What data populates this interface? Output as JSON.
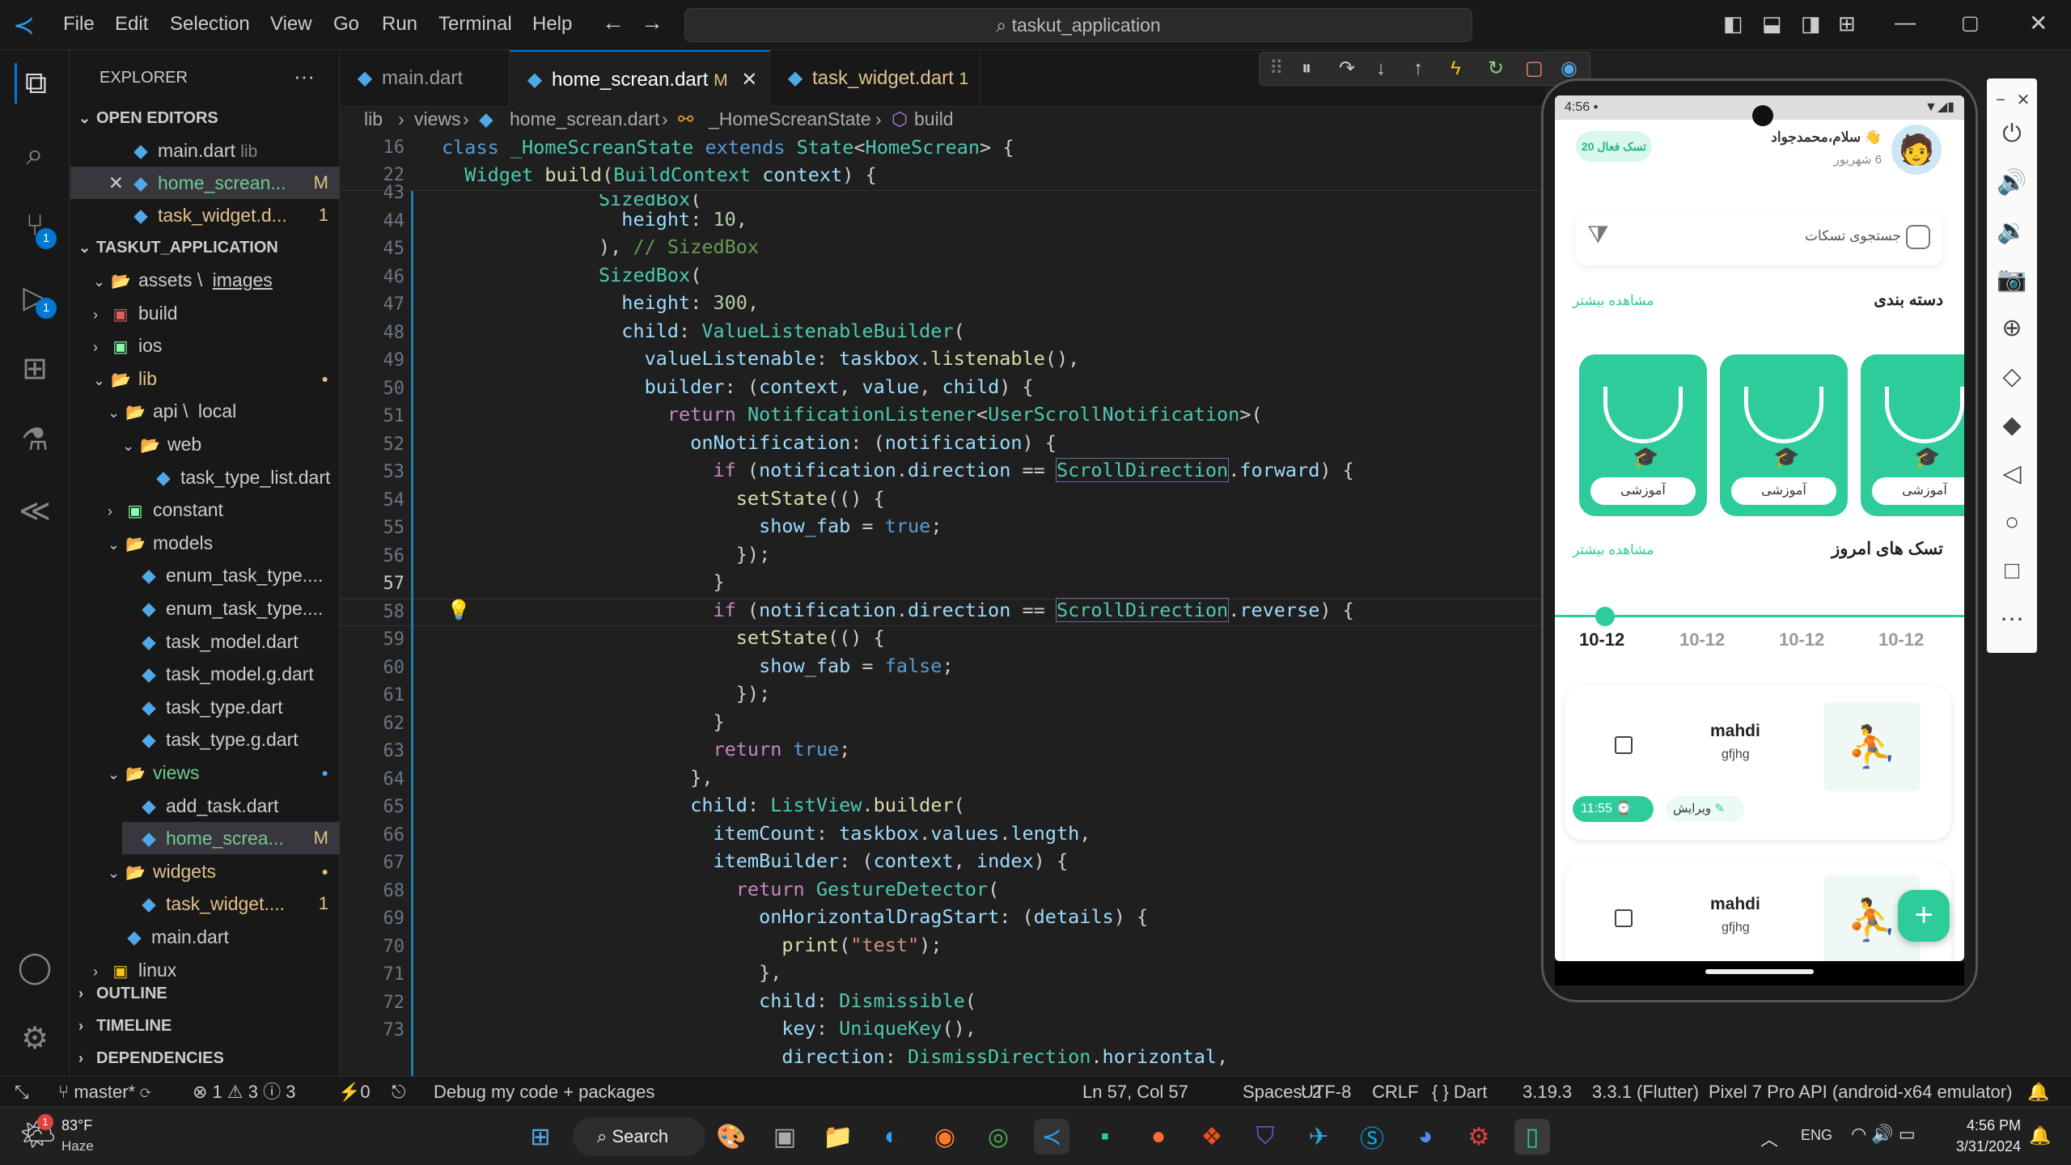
{
  "titlebar": {
    "menus": [
      "File",
      "Edit",
      "Selection",
      "View",
      "Go",
      "Run",
      "Terminal",
      "Help"
    ],
    "search": "taskut_application"
  },
  "sidebar": {
    "title": "EXPLORER",
    "open_editors_label": "OPEN EDITORS",
    "open_editors": [
      {
        "name": "main.dart",
        "detail": "lib"
      },
      {
        "name": "home_screan...",
        "mark": "M"
      },
      {
        "name": "task_widget.d...",
        "mark": "1"
      }
    ],
    "project_label": "TASKUT_APPLICATION",
    "tree": [
      {
        "name": "assets",
        "sub": "images"
      },
      {
        "name": "build"
      },
      {
        "name": "ios"
      },
      {
        "name": "lib"
      },
      {
        "name": "api",
        "sub": "local"
      },
      {
        "name": "web"
      },
      {
        "name": "task_type_list.dart"
      },
      {
        "name": "constant"
      },
      {
        "name": "models"
      },
      {
        "name": "enum_task_type...."
      },
      {
        "name": "enum_task_type...."
      },
      {
        "name": "task_model.dart"
      },
      {
        "name": "task_model.g.dart"
      },
      {
        "name": "task_type.dart"
      },
      {
        "name": "task_type.g.dart"
      },
      {
        "name": "views"
      },
      {
        "name": "add_task.dart"
      },
      {
        "name": "home_screa...",
        "mark": "M"
      },
      {
        "name": "widgets"
      },
      {
        "name": "task_widget....",
        "mark": "1"
      },
      {
        "name": "main.dart"
      },
      {
        "name": "linux"
      }
    ],
    "outline": "OUTLINE",
    "timeline": "TIMELINE",
    "deps": "DEPENDENCIES"
  },
  "tabs": [
    {
      "name": "main.dart"
    },
    {
      "name": "home_screan.dart",
      "mark": "M"
    },
    {
      "name": "task_widget.dart",
      "mark": "1"
    }
  ],
  "breadcrumb": {
    "p1": "lib",
    "p2": "views",
    "p3": "home_screan.dart",
    "p4": "_HomeScreanState",
    "p5": "build"
  },
  "sticky": {
    "l1": "16",
    "l2": "22"
  },
  "lines": [
    "43",
    "44",
    "45",
    "46",
    "47",
    "48",
    "49",
    "50",
    "51",
    "52",
    "53",
    "54",
    "55",
    "56",
    "57",
    "58",
    "59",
    "60",
    "61",
    "62",
    "63",
    "64",
    "65",
    "66",
    "67",
    "68",
    "69",
    "70",
    "71",
    "72",
    "73"
  ],
  "statusbar": {
    "branch": "master*",
    "problems": "⊗ 1 ⚠ 3 ⓘ 3",
    "ports": "⚡0",
    "debug": "Debug my code + packages",
    "pos": "Ln 57, Col 57",
    "spaces": "Spaces: 2",
    "enc": "UTF-8",
    "eol": "CRLF",
    "lang": "{ } Dart",
    "ver": "3.19.3",
    "flutter": "3.3.1 (Flutter)",
    "device": "Pixel 7 Pro API (android-x64 emulator)"
  },
  "taskbar": {
    "temp": "83°F",
    "weather": "Haze",
    "search": "Search",
    "lang": "ENG",
    "time": "4:56 PM",
    "date": "3/31/2024"
  },
  "phone": {
    "time": "4:56",
    "greeting": "سلام،محمدجواد",
    "date": "6 شهریور",
    "active": "20 تسک فعال",
    "search": "جستجوی تسکات",
    "cat_title": "دسته بندی",
    "more": "مشاهده بیشتر",
    "cat_label": "آموزشی",
    "today": "تسک های امروز",
    "dates": [
      "10-12",
      "10-12",
      "10-12",
      "10-12"
    ],
    "tasks": [
      {
        "title": "mahdi",
        "sub": "gfjhg",
        "time": "11:55",
        "edit": "ویرایش"
      },
      {
        "title": "mahdi",
        "sub": "gfjhg"
      }
    ]
  }
}
